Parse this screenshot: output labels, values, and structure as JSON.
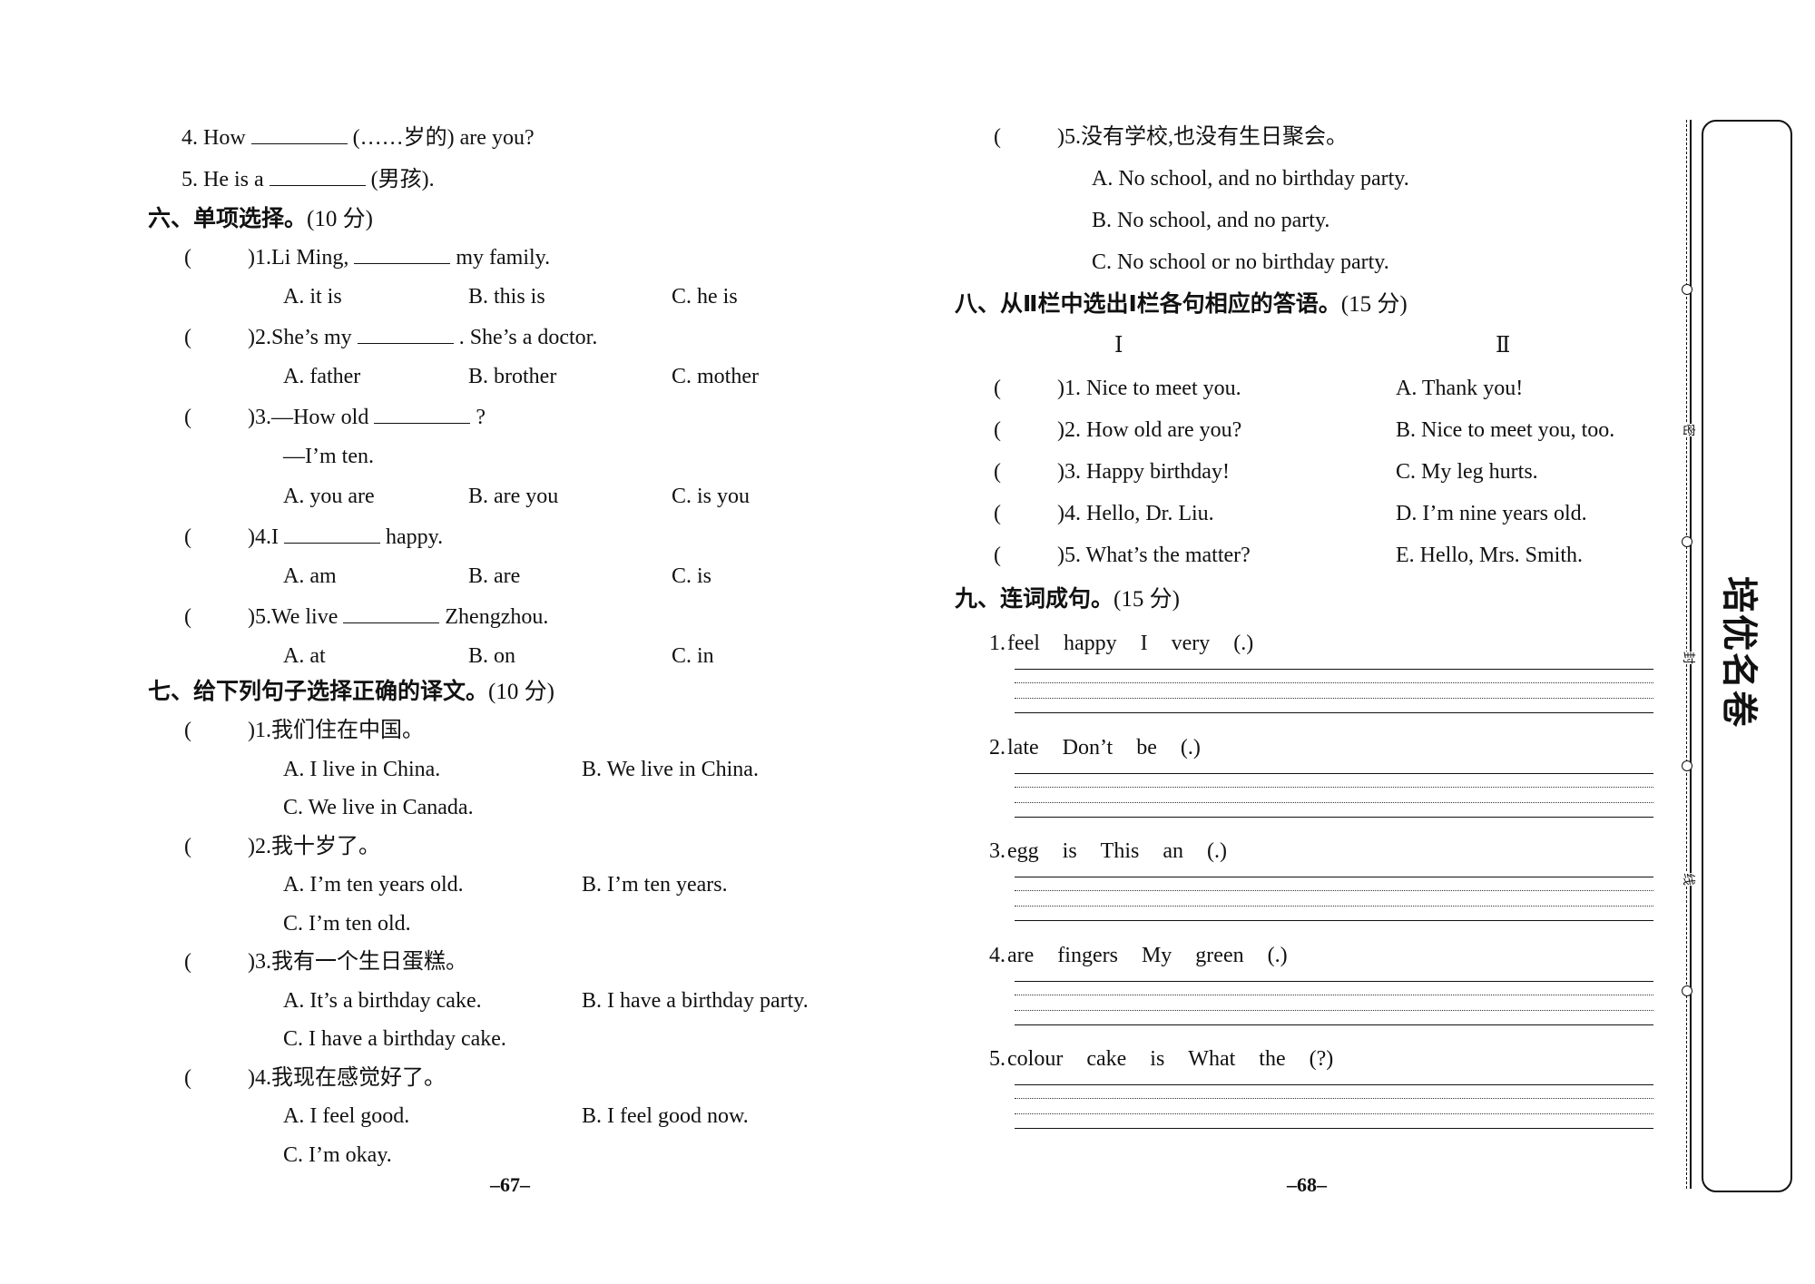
{
  "left_page": {
    "prev_items": [
      {
        "num": "4.",
        "before": "How",
        "after": "(……岁的) are you?"
      },
      {
        "num": "5.",
        "before": "He is a",
        "after": "(男孩)."
      }
    ],
    "section6": {
      "title": "六、单项选择。",
      "points": "(10 分)",
      "questions": [
        {
          "num": ")1.",
          "stem_before": "Li Ming,",
          "stem_after": "my family.",
          "options": [
            "A. it is",
            "B. this is",
            "C. he is"
          ]
        },
        {
          "num": ")2.",
          "stem_before": "She’s my",
          "stem_after": ". She’s a doctor.",
          "options": [
            "A. father",
            "B. brother",
            "C. mother"
          ]
        },
        {
          "num": ")3.",
          "stem_before": "—How old",
          "stem_after": "?",
          "reply": "—I’m ten.",
          "options": [
            "A. you are",
            "B. are you",
            "C. is you"
          ]
        },
        {
          "num": ")4.",
          "stem_before": "I",
          "stem_after": "happy.",
          "options": [
            "A. am",
            "B. are",
            "C. is"
          ]
        },
        {
          "num": ")5.",
          "stem_before": "We live",
          "stem_after": "Zhengzhou.",
          "options": [
            "A. at",
            "B. on",
            "C. in"
          ]
        }
      ]
    },
    "section7": {
      "title": "七、给下列句子选择正确的译文。",
      "points": "(10 分)",
      "questions": [
        {
          "num": ")1.",
          "stem": "我们住在中国。",
          "options": [
            "A. I live in China.",
            "B. We live in China.",
            "C. We live in Canada."
          ]
        },
        {
          "num": ")2.",
          "stem": "我十岁了。",
          "options": [
            "A. I’m ten years old.",
            "B. I’m ten years.",
            "C. I’m ten old."
          ]
        },
        {
          "num": ")3.",
          "stem": "我有一个生日蛋糕。",
          "options": [
            "A. It’s a birthday cake.",
            "B. I have a birthday party.",
            "C. I have a birthday cake."
          ]
        },
        {
          "num": ")4.",
          "stem": "我现在感觉好了。",
          "options": [
            "A. I feel good.",
            "B. I feel good now.",
            "C. I’m okay."
          ]
        }
      ]
    },
    "page_number": "–67–"
  },
  "right_page": {
    "section7_cont": {
      "num": ")5.",
      "stem": "没有学校,也没有生日聚会。",
      "options": [
        "A. No school, and no birthday party.",
        "B. No school, and no party.",
        "C. No school or no birthday party."
      ]
    },
    "section8": {
      "title": "八、从Ⅱ栏中选出Ⅰ栏各句相应的答语。",
      "points": "(15 分)",
      "col1_header": "Ⅰ",
      "col2_header": "Ⅱ",
      "col1": [
        ")1. Nice to meet you.",
        ")2. How old are you?",
        ")3. Happy birthday!",
        ")4. Hello, Dr. Liu.",
        ")5. What’s the matter?"
      ],
      "col2": [
        "A. Thank you!",
        "B. Nice to meet you, too.",
        "C. My leg hurts.",
        "D. I’m nine years old.",
        "E. Hello, Mrs. Smith."
      ]
    },
    "section9": {
      "title": "九、连词成句。",
      "points": "(15 分)",
      "items": [
        {
          "num": "1.",
          "words": [
            "feel",
            "happy",
            "I",
            "very",
            "(.)"
          ]
        },
        {
          "num": "2.",
          "words": [
            "late",
            "Don’t",
            "be",
            "(.)"
          ]
        },
        {
          "num": "3.",
          "words": [
            "egg",
            "is",
            "This",
            "an",
            "(.)"
          ]
        },
        {
          "num": "4.",
          "words": [
            "are",
            "fingers",
            "My",
            "green",
            "(.)"
          ]
        },
        {
          "num": "5.",
          "words": [
            "colour",
            "cake",
            "is",
            "What",
            "the",
            "(?)"
          ]
        }
      ]
    },
    "page_number": "–68–"
  },
  "binding_margin": {
    "seal_chars": [
      "密",
      "封",
      "线"
    ],
    "logo_text": "培优名卷"
  },
  "answer_paren": "("
}
